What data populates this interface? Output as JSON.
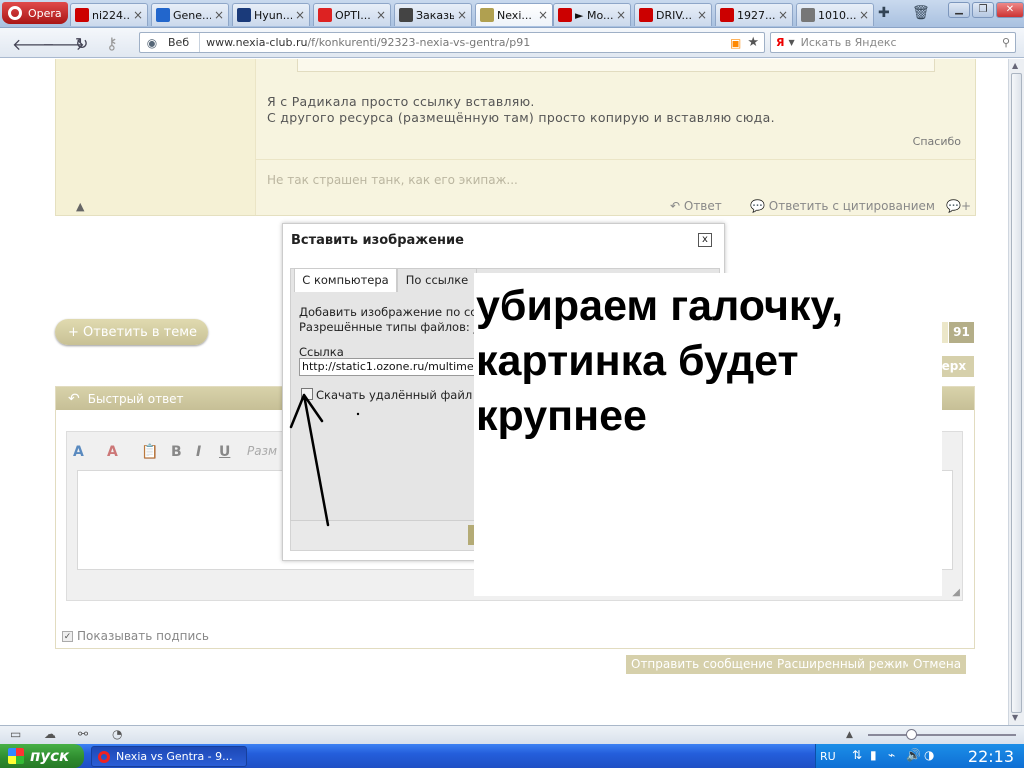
{
  "browser": {
    "app_label": "Opera",
    "tabs": [
      {
        "label": "ni224...",
        "icon": "a-letter-icon",
        "color": "#cc0000"
      },
      {
        "label": "Gene...",
        "icon": "colored-e-icon",
        "color": "#2266cc"
      },
      {
        "label": "Hyun...",
        "icon": "hyundai-icon",
        "color": "#1a3a7a"
      },
      {
        "label": "OPTI...",
        "icon": "yandex-icon",
        "color": "#dd2222"
      },
      {
        "label": "Заказы",
        "icon": "e-letter-icon",
        "color": "#444444"
      },
      {
        "label": "Nexi...",
        "icon": "nexia-icon",
        "color": "#b0a050"
      },
      {
        "label": "► Mo...",
        "icon": "video-icon",
        "color": "#cc0000"
      },
      {
        "label": "DRIV...",
        "icon": "d-letter-icon",
        "color": "#cc0000"
      },
      {
        "label": "1927...",
        "icon": "u-letter-icon",
        "color": "#cc0000"
      },
      {
        "label": "1010...",
        "icon": "avatar-icon",
        "color": "#777777"
      }
    ],
    "address": {
      "scope_label": "Веб",
      "url_host": "www.nexia-club.ru",
      "url_path": "/f/konkurenti/92323-nexia-vs-gentra/p91"
    },
    "search": {
      "placeholder": "Искать в Яндекс"
    }
  },
  "post": {
    "lines": [
      "Я с Радикала просто ссылку вставляю.",
      "С другого ресурса (размещённую там) просто копирую и вставляю сюда."
    ],
    "thanks_label": "Спасибо",
    "signature": "Не так страшен танк, как его экипаж...",
    "actions": {
      "reply": "Ответ",
      "reply_quote": "Ответить с цитированием"
    }
  },
  "thread": {
    "reply_theme_label": "+ Ответить в теме",
    "page_number": "91",
    "up_label": "верх"
  },
  "quick_reply": {
    "title": "Быстрый ответ",
    "toolbar_placeholder": "Разм",
    "show_signature_label": "Показывать подпись",
    "show_signature_checked": true,
    "buttons": {
      "send": "Отправить сообщение",
      "advanced": "Расширенный режим",
      "cancel": "Отмена"
    }
  },
  "dialog": {
    "title": "Вставить изображение",
    "close_label": "x",
    "tabs": [
      "С компьютера",
      "По ссылке"
    ],
    "active_tab": "По ссылке",
    "desc_line1": "Добавить изображение по ссы",
    "desc_line2": "Разрешённые типы файлов: jpg",
    "link_label": "Ссылка",
    "link_value": "http://static1.ozone.ru/multimedia",
    "download_label": "Скачать удалённый файл и",
    "download_checked": false
  },
  "annotation": {
    "text": "убираем галочку,\nкартинка будет\nкрупнее"
  },
  "statusbar": {},
  "taskbar": {
    "start_label": "пуск",
    "task_label": "Nexia vs Gentra - 9...",
    "lang": "RU",
    "clock": "22:13"
  }
}
